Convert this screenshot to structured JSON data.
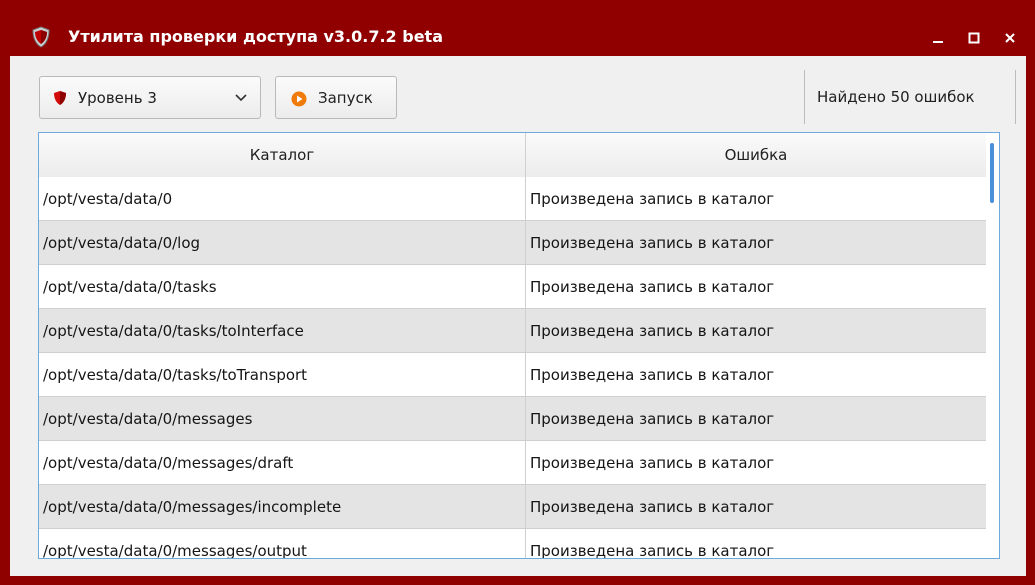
{
  "window": {
    "title": "Утилита проверки доступа v3.0.7.2 beta",
    "controls": [
      "minimize",
      "maximize",
      "close"
    ]
  },
  "toolbar": {
    "level_label": "Уровень 3",
    "run_label": "Запуск",
    "status_text": "Найдено 50 ошибок"
  },
  "table": {
    "columns": [
      "Каталог",
      "Ошибка"
    ],
    "rows": [
      [
        "/opt/vesta/data/0",
        "Произведена запись в каталог"
      ],
      [
        "/opt/vesta/data/0/log",
        "Произведена запись в каталог"
      ],
      [
        "/opt/vesta/data/0/tasks",
        "Произведена запись в каталог"
      ],
      [
        "/opt/vesta/data/0/tasks/toInterface",
        "Произведена запись в каталог"
      ],
      [
        "/opt/vesta/data/0/tasks/toTransport",
        "Произведена запись в каталог"
      ],
      [
        "/opt/vesta/data/0/messages",
        "Произведена запись в каталог"
      ],
      [
        "/opt/vesta/data/0/messages/draft",
        "Произведена запись в каталог"
      ],
      [
        "/opt/vesta/data/0/messages/incomplete",
        "Произведена запись в каталог"
      ],
      [
        "/opt/vesta/data/0/messages/output",
        "Произведена запись в каталог"
      ]
    ]
  },
  "colors": {
    "titlebar": "#900000",
    "accent": "#4a90d9",
    "row_alt": "#e4e4e4"
  }
}
